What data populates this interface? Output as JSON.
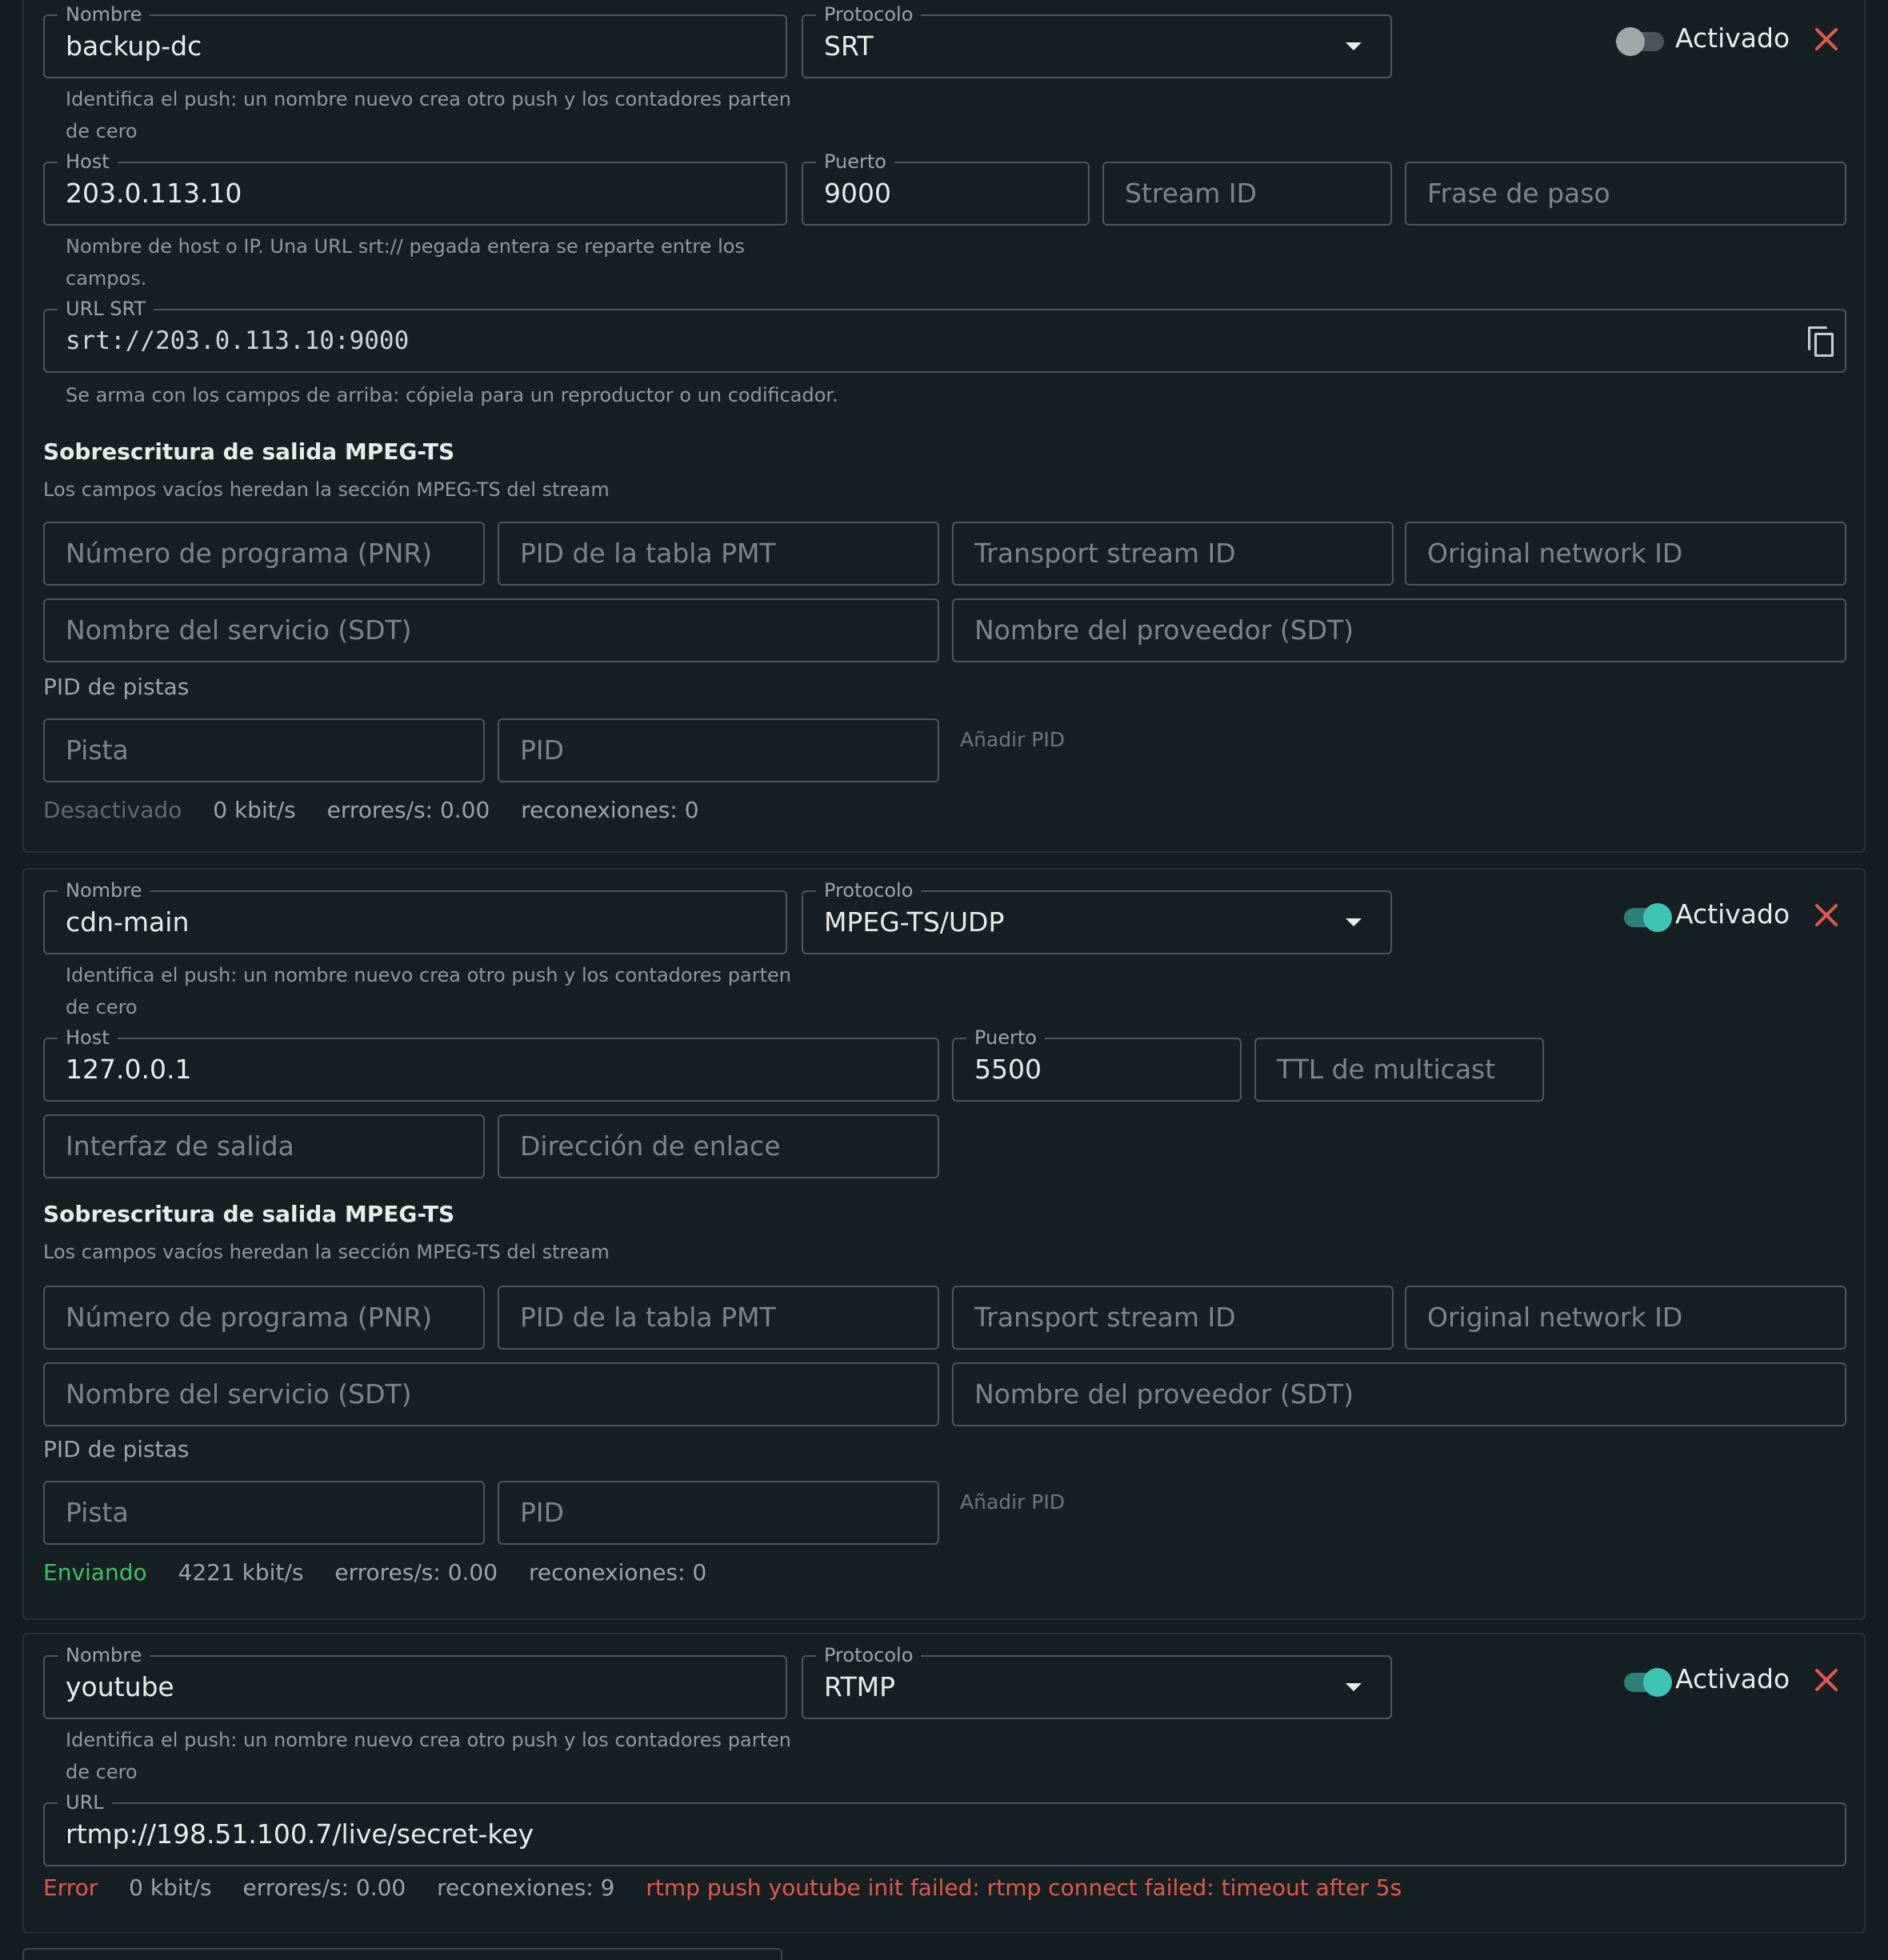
{
  "common": {
    "name_label": "Nombre",
    "protocol_label": "Protocolo",
    "enabled_label": "Activado",
    "name_help": "Identifica el push: un nombre nuevo crea otro push y los contadores parten de cero",
    "host_label": "Host",
    "port_label": "Puerto",
    "mpegts_title": "Sobrescritura de salida MPEG-TS",
    "mpegts_sub": "Los campos vacíos heredan la sección MPEG-TS del stream",
    "pnr_placeholder": "Número de programa (PNR)",
    "pmt_placeholder": "PID de la tabla PMT",
    "tsid_placeholder": "Transport stream ID",
    "onid_placeholder": "Original network ID",
    "service_placeholder": "Nombre del servicio (SDT)",
    "provider_placeholder": "Nombre del proveedor (SDT)",
    "track_pids_label": "PID de pistas",
    "track_placeholder": "Pista",
    "pid_placeholder": "PID",
    "add_pid": "Añadir PID"
  },
  "pushes": [
    {
      "name": "backup-dc",
      "protocol": "SRT",
      "enabled": false,
      "host": "203.0.113.10",
      "host_help": "Nombre de host o IP. Una URL srt:// pegada entera se reparte entre los campos.",
      "port": "9000",
      "stream_id_placeholder": "Stream ID",
      "passphrase_placeholder": "Frase de paso",
      "srt_url_label": "URL SRT",
      "srt_url": "srt://203.0.113.10:9000",
      "srt_url_help": "Se arma con los campos de arriba: cópiela para un reproductor o un codificador.",
      "status": "Desactivado",
      "bitrate": "0 kbit/s",
      "errors": "errores/s: 0.00",
      "reconnects": "reconexiones: 0"
    },
    {
      "name": "cdn-main",
      "protocol": "MPEG-TS/UDP",
      "enabled": true,
      "host": "127.0.0.1",
      "port": "5500",
      "ttl_placeholder": "TTL de multicast",
      "iface_placeholder": "Interfaz de salida",
      "bind_placeholder": "Dirección de enlace",
      "status": "Enviando",
      "bitrate": "4221 kbit/s",
      "errors": "errores/s: 0.00",
      "reconnects": "reconexiones: 0"
    },
    {
      "name": "youtube",
      "protocol": "RTMP",
      "enabled": true,
      "url_label": "URL",
      "url": "rtmp://198.51.100.7/live/secret-key",
      "status": "Error",
      "bitrate": "0 kbit/s",
      "errors": "errores/s: 0.00",
      "reconnects": "reconexiones: 9",
      "error_message": "rtmp push youtube init failed: rtmp connect failed: timeout after 5s"
    }
  ],
  "colors": {
    "background": "#141d1f",
    "accent_toggle": "#3fc4b3",
    "status_ok": "#3fbf6a",
    "status_error": "#e0584f"
  }
}
